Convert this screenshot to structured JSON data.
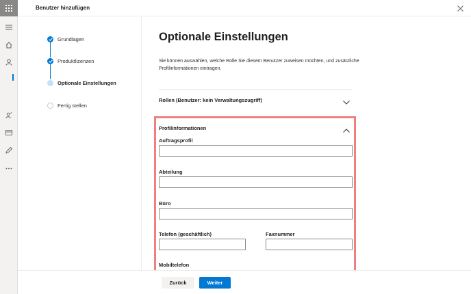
{
  "panel": {
    "title": "Benutzer hinzufügen"
  },
  "steps": [
    {
      "label": "Grundlagen",
      "state": "done"
    },
    {
      "label": "Produktlizenzen",
      "state": "done"
    },
    {
      "label": "Optionale Einstellungen",
      "state": "current"
    },
    {
      "label": "Fertig stellen",
      "state": "todo"
    }
  ],
  "main": {
    "heading": "Optionale Einstellungen",
    "description": "Sie können auswählen, welche Rolle Sie diesem Benutzer zuweisen möchten, und zusätzliche Profilinformationen eintragen.",
    "roles_label": "Rollen (Benutzer: kein Verwaltungszugriff)",
    "profile_label": "Profilinformationen",
    "fields": {
      "job_title": {
        "label": "Auftragsprofil",
        "value": ""
      },
      "department": {
        "label": "Abteilung",
        "value": ""
      },
      "office": {
        "label": "Büro",
        "value": ""
      },
      "office_phone": {
        "label": "Telefon (geschäftlich)",
        "value": ""
      },
      "fax": {
        "label": "Faxnummer",
        "value": ""
      },
      "mobile": {
        "label": "Mobiltelefon",
        "value": ""
      }
    }
  },
  "footer": {
    "back_label": "Zurück",
    "next_label": "Weiter"
  },
  "colors": {
    "accent": "#0078d4",
    "highlight": "#f08080",
    "rail": "#f3f2f1"
  },
  "icons": {
    "rail": [
      "app-launcher-icon",
      "menu-icon",
      "home-icon",
      "user-icon",
      "groups-icon",
      "billing-icon",
      "edit-icon",
      "more-icon"
    ],
    "close": "close-icon"
  }
}
